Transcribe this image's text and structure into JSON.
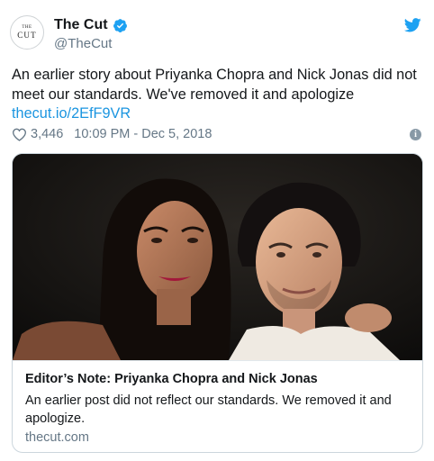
{
  "author": {
    "avatar_top": "THE",
    "avatar_bottom": "CUT",
    "display_name": "The Cut",
    "handle": "@TheCut"
  },
  "tweet": {
    "text": "An earlier story about Priyanka Chopra and Nick Jonas did not meet our standards. We've removed it and apologize",
    "link": "thecut.io/2EfF9VR",
    "likes": "3,446",
    "timestamp": "10:09 PM - Dec 5, 2018"
  },
  "card": {
    "title": "Editor’s Note: Priyanka Chopra and Nick Jonas",
    "description": "An earlier post did not reflect our standards. We removed it and apologize.",
    "domain": "thecut.com"
  },
  "icons": {
    "verified": "verified-badge-icon",
    "brand": "twitter-bird-icon",
    "like": "heart-icon",
    "info": "info-icon"
  },
  "colors": {
    "link": "#1b95e0",
    "twitter_blue": "#1da1f2",
    "muted": "#657786"
  }
}
